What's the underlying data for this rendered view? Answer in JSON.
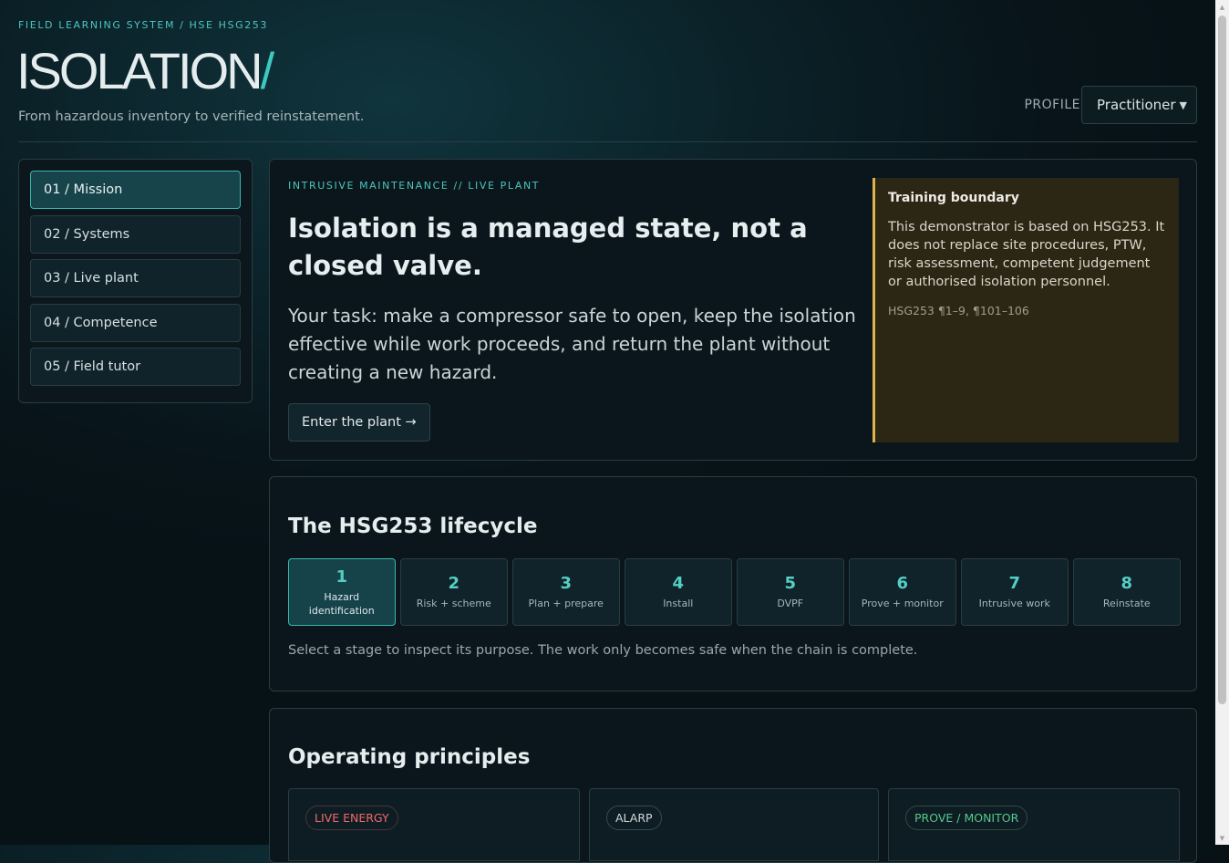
{
  "header": {
    "eyebrow": "FIELD LEARNING SYSTEM / HSE HSG253",
    "brand": "ISOLATION",
    "brand_slash": "/",
    "tagline": "From hazardous inventory to verified reinstatement.",
    "profile_label": "PROFILE",
    "profile_value": "Practitioner"
  },
  "sidebar": {
    "items": [
      {
        "label": "01 / Mission",
        "active": true
      },
      {
        "label": "02 / Systems"
      },
      {
        "label": "03 / Live plant"
      },
      {
        "label": "04 / Competence"
      },
      {
        "label": "05 / Field tutor"
      }
    ]
  },
  "mission": {
    "kicker": "INTRUSIVE MAINTENANCE // LIVE PLANT",
    "title": "Isolation is a managed state, not a closed valve.",
    "lede": "Your task: make a compressor safe to open, keep the isolation effective while work proceeds, and return the plant without creating a new hazard.",
    "cta": "Enter the plant →",
    "boundary": {
      "title": "Training boundary",
      "body": "This demonstrator is based on HSG253. It does not replace site procedures, PTW, risk assessment, competent judgement or authorised isolation personnel.",
      "ref": "HSG253 ¶1–9, ¶101–106"
    }
  },
  "lifecycle": {
    "title": "The HSG253 lifecycle",
    "stages": [
      {
        "num": "1",
        "label": "Hazard identification"
      },
      {
        "num": "2",
        "label": "Risk + scheme"
      },
      {
        "num": "3",
        "label": "Plan + prepare"
      },
      {
        "num": "4",
        "label": "Install"
      },
      {
        "num": "5",
        "label": "DVPF"
      },
      {
        "num": "6",
        "label": "Prove + monitor"
      },
      {
        "num": "7",
        "label": "Intrusive work"
      },
      {
        "num": "8",
        "label": "Reinstate"
      }
    ],
    "hint": "Select a stage to inspect its purpose. The work only becomes safe when the chain is complete."
  },
  "principles": {
    "title": "Operating principles",
    "tags": [
      "LIVE ENERGY",
      "ALARP",
      "PROVE / MONITOR"
    ]
  },
  "colors": {
    "accent": "#3cc9bf",
    "warning_border": "#e0b24c",
    "tag_red": "#f06a6a",
    "tag_green": "#55c98a"
  }
}
